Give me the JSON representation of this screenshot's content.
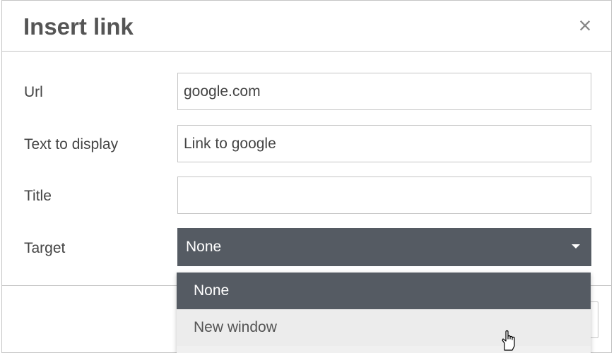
{
  "dialog": {
    "title": "Insert link",
    "close_glyph": "×"
  },
  "form": {
    "url": {
      "label": "Url",
      "value": "google.com"
    },
    "text": {
      "label": "Text to display",
      "value": "Link to google"
    },
    "title": {
      "label": "Title",
      "value": ""
    },
    "target": {
      "label": "Target",
      "selected": "None"
    }
  },
  "dropdown": {
    "options": [
      "None",
      "New window"
    ]
  },
  "colors": {
    "select_bg": "#555b63",
    "menu_bg": "#f0f0f0",
    "border": "#c5c5c5"
  },
  "icons": {
    "close": "close-icon",
    "caret": "caret-down-icon",
    "cursor": "hand-pointer-icon"
  }
}
